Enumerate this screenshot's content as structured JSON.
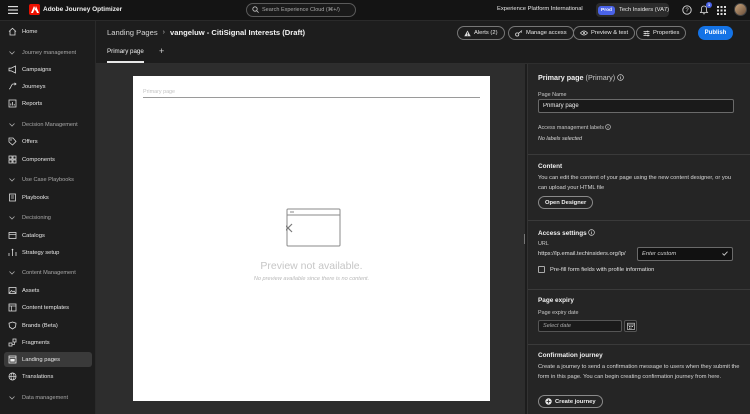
{
  "app": {
    "title": "Adobe Journey Optimizer",
    "org_name": "Experience Platform International",
    "sandbox_badge": "Prod",
    "sandbox_name": "Tech Insiders (VA7)",
    "notification_count": "1"
  },
  "search": {
    "placeholder": "Search Experience Cloud (⌘+/)"
  },
  "sidebar": {
    "home": "Home",
    "sections": {
      "journey_management": "Journey management",
      "decision_management": "Decision Management",
      "use_case_playbooks": "Use Case Playbooks",
      "decisioning": "Decisioning",
      "content_management": "Content Management",
      "data_management": "Data management"
    },
    "items": {
      "campaigns": "Campaigns",
      "journeys": "Journeys",
      "reports": "Reports",
      "offers": "Offers",
      "components": "Components",
      "playbooks": "Playbooks",
      "catalogs": "Catalogs",
      "strategy_setup": "Strategy setup",
      "assets": "Assets",
      "content_templates": "Content templates",
      "brands": "Brands (Beta)",
      "fragments": "Fragments",
      "landing_pages": "Landing pages",
      "translations": "Translations"
    },
    "active": "landing_pages"
  },
  "header": {
    "breadcrumb_parent": "Landing Pages",
    "breadcrumb_current": "vangeluw - CitiSignal Interests (Draft)",
    "alerts": "Alerts (2)",
    "manage_access": "Manage access",
    "preview_test": "Preview & test",
    "properties": "Properties",
    "publish": "Publish",
    "tab_primary": "Primary page"
  },
  "canvas": {
    "field_placeholder": "Primary page",
    "preview_title": "Preview not available.",
    "preview_sub": "No preview available since there is no content."
  },
  "panel": {
    "title_main": "Primary page",
    "title_sub": "(Primary)",
    "page_name_label": "Page Name",
    "page_name_value": "Primary page",
    "access_labels_label": "Access management labels",
    "no_labels": "No labels selected",
    "content_title": "Content",
    "content_text": "You can edit the content of your page using the new content designer, or you can upload your HTML file",
    "open_designer": "Open Designer",
    "access_settings_title": "Access settings",
    "url_label": "URL",
    "url_prefix": "https://lp.email.techinsiders.org/lp/",
    "custom_placeholder": "Enter custom",
    "prefill_label": "Pre-fill form fields with profile information",
    "expiry_title": "Page expiry",
    "expiry_label": "Page expiry date",
    "date_placeholder": "Select date",
    "confirmation_title": "Confirmation journey",
    "confirmation_text": "Create a journey to send a confirmation message to users when they submit the form in this page. You can begin creating confirmation journey from here.",
    "create_journey": "Create journey"
  },
  "colors": {
    "accent": "#1473e6",
    "prod_badge": "#4a63e8",
    "adobe_red": "#eb1000"
  }
}
